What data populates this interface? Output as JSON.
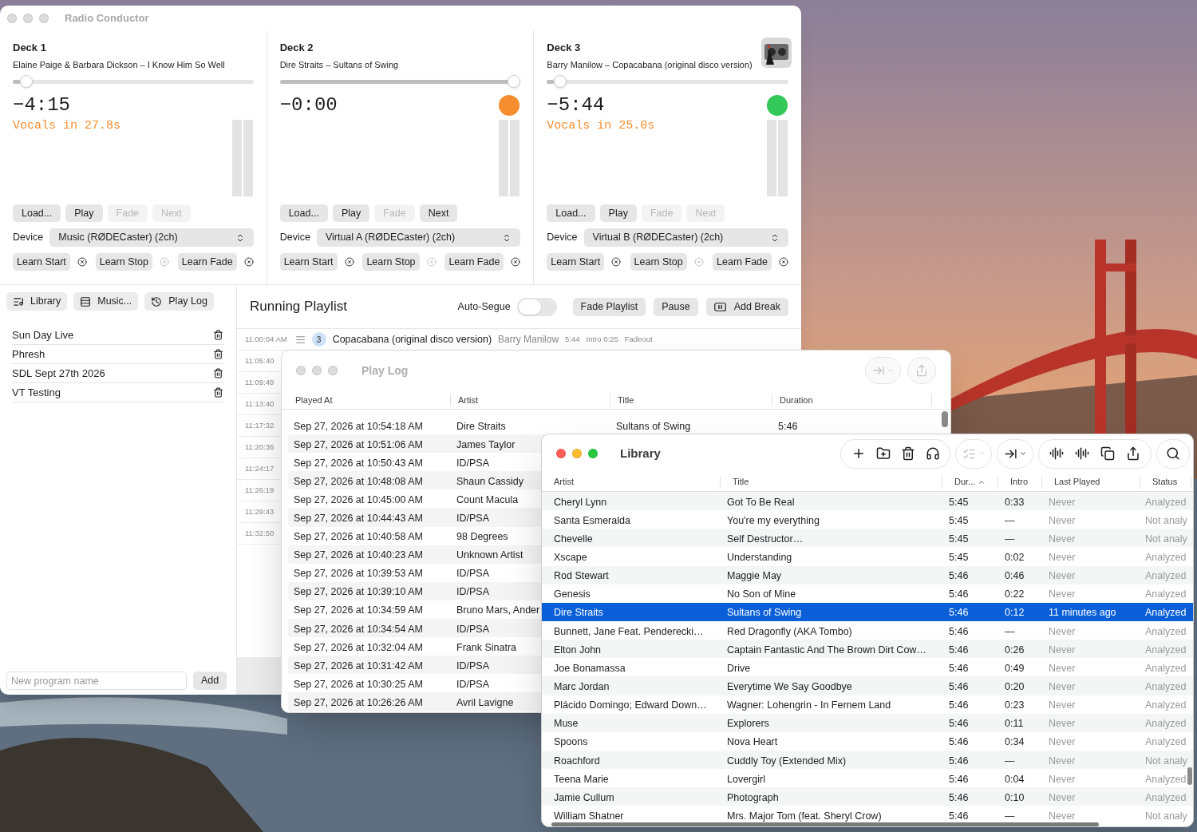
{
  "main_window": {
    "title": "Radio Conductor",
    "decks": [
      {
        "name": "Deck 1",
        "track": "Elaine Paige & Barbara Dickson – I Know Him So Well",
        "level": 0.03,
        "time": "−4:15",
        "vocals": "Vocals in 27.8s",
        "buttons": [
          {
            "label": "Load...",
            "disabled": false
          },
          {
            "label": "Play",
            "disabled": false
          },
          {
            "label": "Fade",
            "disabled": true
          },
          {
            "label": "Next",
            "disabled": true
          }
        ],
        "device": {
          "label": "Device",
          "value": "Music (RØDECaster) (2ch)"
        },
        "learn": [
          {
            "label": "Learn Start",
            "clear_disabled": false
          },
          {
            "label": "Learn Stop",
            "clear_disabled": true
          },
          {
            "label": "Learn Fade",
            "clear_disabled": false
          }
        ]
      },
      {
        "name": "Deck 2",
        "track": "Dire Straits – Sultans of Swing",
        "level": 1.0,
        "time": "−0:00",
        "color": "#f68d2e",
        "buttons": [
          {
            "label": "Load...",
            "disabled": false
          },
          {
            "label": "Play",
            "disabled": false
          },
          {
            "label": "Fade",
            "disabled": true
          },
          {
            "label": "Next",
            "disabled": false
          }
        ],
        "device": {
          "label": "Device",
          "value": "Virtual A (RØDECaster) (2ch)"
        },
        "learn": [
          {
            "label": "Learn Start",
            "clear_disabled": false
          },
          {
            "label": "Learn Stop",
            "clear_disabled": true
          },
          {
            "label": "Learn Fade",
            "clear_disabled": false
          }
        ]
      },
      {
        "name": "Deck 3",
        "track": "Barry Manilow – Copacabana (original disco version)",
        "artwork": true,
        "level": 0.03,
        "time": "−5:44",
        "vocals": "Vocals in 25.0s",
        "color": "#34c759",
        "buttons": [
          {
            "label": "Load...",
            "disabled": false
          },
          {
            "label": "Play",
            "disabled": false
          },
          {
            "label": "Fade",
            "disabled": true
          },
          {
            "label": "Next",
            "disabled": true
          }
        ],
        "device": {
          "label": "Device",
          "value": "Virtual B (RØDECaster) (2ch)"
        },
        "learn": [
          {
            "label": "Learn Start",
            "clear_disabled": false
          },
          {
            "label": "Learn Stop",
            "clear_disabled": true
          },
          {
            "label": "Learn Fade",
            "clear_disabled": false
          }
        ]
      }
    ],
    "sidebar": {
      "views": [
        "Library",
        "Music...",
        "Play Log"
      ],
      "programs": [
        "Sun Day Live",
        "Phresh",
        "SDL Sept 27th 2026",
        "VT Testing"
      ],
      "new_program": {
        "placeholder": "New program name",
        "button": "Add"
      }
    },
    "playlist": {
      "title": "Running Playlist",
      "auto_segue": {
        "label": "Auto-Segue",
        "on": false
      },
      "buttons": [
        "Fade Playlist",
        "Pause",
        "Add Break"
      ],
      "rows": [
        {
          "time": "11:00:04 AM",
          "number": "3",
          "title": "Copacabana (original disco version)",
          "artist": "Barry Manilow",
          "duration": "5:44",
          "intro": "Intro 0:25",
          "ending": "Fadeout"
        },
        {
          "time": "11:05:40"
        },
        {
          "time": "11:09:49"
        },
        {
          "time": "11:13:40"
        },
        {
          "time": "11:17:32"
        },
        {
          "time": "11:20:36"
        },
        {
          "time": "11:24:17"
        },
        {
          "time": "11:26:19"
        },
        {
          "time": "11:29:43"
        },
        {
          "time": "11:32:50"
        }
      ]
    }
  },
  "play_log": {
    "title": "Play Log",
    "columns": [
      "Played At",
      "Artist",
      "Title",
      "Duration"
    ],
    "rows": [
      {
        "played_at": "Sep 27, 2026 at 10:54:18 AM",
        "artist": "Dire Straits",
        "title": "Sultans of Swing",
        "duration": "5:46"
      },
      {
        "played_at": "Sep 27, 2026 at 10:51:06 AM",
        "artist": "James Taylor"
      },
      {
        "played_at": "Sep 27, 2026 at 10:50:43 AM",
        "artist": "ID/PSA"
      },
      {
        "played_at": "Sep 27, 2026 at 10:48:08 AM",
        "artist": "Shaun Cassidy"
      },
      {
        "played_at": "Sep 27, 2026 at 10:45:00 AM",
        "artist": "Count Macula"
      },
      {
        "played_at": "Sep 27, 2026 at 10:44:43 AM",
        "artist": "ID/PSA"
      },
      {
        "played_at": "Sep 27, 2026 at 10:40:58 AM",
        "artist": "98 Degrees"
      },
      {
        "played_at": "Sep 27, 2026 at 10:40:23 AM",
        "artist": "Unknown Artist"
      },
      {
        "played_at": "Sep 27, 2026 at 10:39:53 AM",
        "artist": "ID/PSA"
      },
      {
        "played_at": "Sep 27, 2026 at 10:39:10 AM",
        "artist": "ID/PSA"
      },
      {
        "played_at": "Sep 27, 2026 at 10:34:59 AM",
        "artist": "Bruno Mars, Ander"
      },
      {
        "played_at": "Sep 27, 2026 at 10:34:54 AM",
        "artist": "ID/PSA"
      },
      {
        "played_at": "Sep 27, 2026 at 10:32:04 AM",
        "artist": "Frank Sinatra"
      },
      {
        "played_at": "Sep 27, 2026 at 10:31:42 AM",
        "artist": "ID/PSA"
      },
      {
        "played_at": "Sep 27, 2026 at 10:30:25 AM",
        "artist": "ID/PSA"
      },
      {
        "played_at": "Sep 27, 2026 at 10:26:26 AM",
        "artist": "Avril Lavigne"
      }
    ]
  },
  "library": {
    "title": "Library",
    "columns": [
      "Artist",
      "Title",
      "Dur...",
      "Intro",
      "Last Played",
      "Status"
    ],
    "rows": [
      {
        "artist": "Cheryl Lynn",
        "title": "Got To Be Real",
        "duration": "5:45",
        "intro": "0:33",
        "last_played": "Never",
        "status": "Analyzed",
        "selected": false
      },
      {
        "artist": "Santa Esmeralda",
        "title": "You're my everything",
        "duration": "5:45",
        "intro": "—",
        "last_played": "Never",
        "status": "Not analy",
        "selected": false
      },
      {
        "artist": "Chevelle",
        "title": "Self Destructor…",
        "duration": "5:45",
        "intro": "—",
        "last_played": "Never",
        "status": "Not analy",
        "selected": false
      },
      {
        "artist": "Xscape",
        "title": "Understanding",
        "duration": "5:45",
        "intro": "0:02",
        "last_played": "Never",
        "status": "Analyzed",
        "selected": false
      },
      {
        "artist": "Rod Stewart",
        "title": "Maggie May",
        "duration": "5:46",
        "intro": "0:46",
        "last_played": "Never",
        "status": "Analyzed",
        "selected": false
      },
      {
        "artist": "Genesis",
        "title": "No Son of Mine",
        "duration": "5:46",
        "intro": "0:22",
        "last_played": "Never",
        "status": "Analyzed",
        "selected": false
      },
      {
        "artist": "Dire Straits",
        "title": "Sultans of Swing",
        "duration": "5:46",
        "intro": "0:12",
        "last_played": "11 minutes ago",
        "status": "Analyzed",
        "selected": true
      },
      {
        "artist": "Bunnett, Jane Feat. Penderecki…",
        "title": "Red Dragonfly (AKA Tombo)",
        "duration": "5:46",
        "intro": "—",
        "last_played": "Never",
        "status": "Analyzed",
        "selected": false
      },
      {
        "artist": "Elton John",
        "title": "Captain Fantastic And The Brown Dirt Cow…",
        "duration": "5:46",
        "intro": "0:26",
        "last_played": "Never",
        "status": "Analyzed",
        "selected": false
      },
      {
        "artist": "Joe Bonamassa",
        "title": "Drive",
        "duration": "5:46",
        "intro": "0:49",
        "last_played": "Never",
        "status": "Analyzed",
        "selected": false
      },
      {
        "artist": "Marc Jordan",
        "title": "Everytime We Say Goodbye",
        "duration": "5:46",
        "intro": "0:20",
        "last_played": "Never",
        "status": "Analyzed",
        "selected": false
      },
      {
        "artist": "Plácido Domingo; Edward Down…",
        "title": "Wagner: Lohengrin - In Fernem Land",
        "duration": "5:46",
        "intro": "0:23",
        "last_played": "Never",
        "status": "Analyzed",
        "selected": false
      },
      {
        "artist": "Muse",
        "title": "Explorers",
        "duration": "5:46",
        "intro": "0:11",
        "last_played": "Never",
        "status": "Analyzed",
        "selected": false
      },
      {
        "artist": "Spoons",
        "title": "Nova Heart",
        "duration": "5:46",
        "intro": "0:34",
        "last_played": "Never",
        "status": "Analyzed",
        "selected": false
      },
      {
        "artist": "Roachford",
        "title": "Cuddly Toy (Extended Mix)",
        "duration": "5:46",
        "intro": "—",
        "last_played": "Never",
        "status": "Not analy",
        "selected": false
      },
      {
        "artist": "Teena Marie",
        "title": "Lovergirl",
        "duration": "5:46",
        "intro": "0:04",
        "last_played": "Never",
        "status": "Analyzed",
        "selected": false
      },
      {
        "artist": "Jamie Cullum",
        "title": "Photograph",
        "duration": "5:46",
        "intro": "0:10",
        "last_played": "Never",
        "status": "Analyzed",
        "selected": false
      },
      {
        "artist": "William Shatner",
        "title": "Mrs. Major Tom (feat. Sheryl Crow)",
        "duration": "5:46",
        "intro": "—",
        "last_played": "Never",
        "status": "Not analy",
        "selected": false
      }
    ]
  }
}
